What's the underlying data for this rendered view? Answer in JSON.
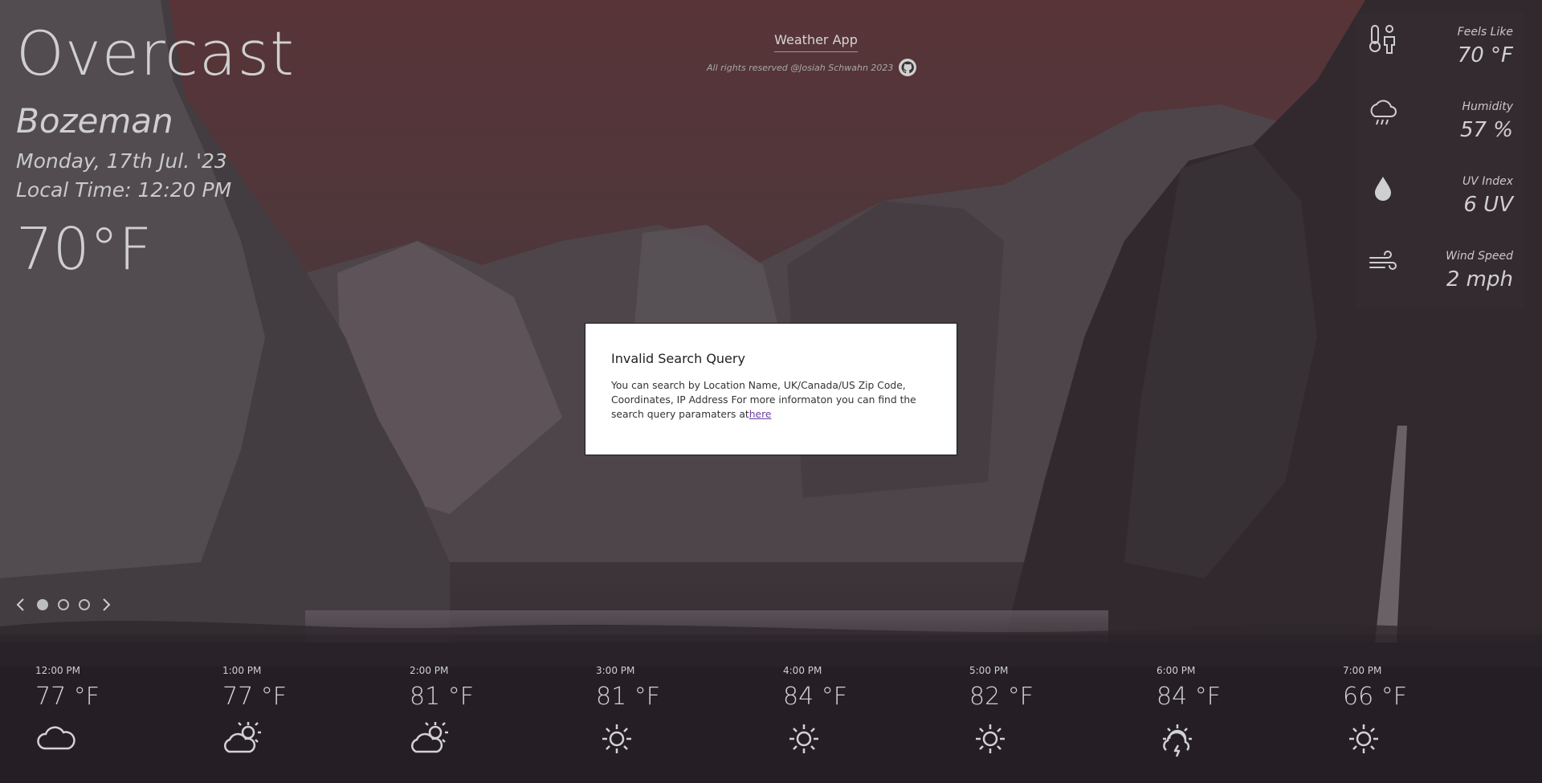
{
  "current": {
    "condition": "Overcast",
    "city": "Bozeman",
    "date": "Monday, 17th Jul. '23",
    "local_time": "Local Time: 12:20 PM",
    "temperature": "70°F"
  },
  "header": {
    "app_name": "Weather App",
    "rights": "All rights reserved @Josiah Schwahn 2023",
    "github_icon": "github-icon"
  },
  "details": [
    {
      "label": "Feels Like",
      "value": "70 °F",
      "icon": "thermometer-person-icon"
    },
    {
      "label": "Humidity",
      "value": "57 %",
      "icon": "cloud-drizzle-icon"
    },
    {
      "label": "UV Index",
      "value": "6 UV",
      "icon": "water-drop-icon"
    },
    {
      "label": "Wind Speed",
      "value": "2 mph",
      "icon": "wind-icon"
    }
  ],
  "modal": {
    "title": "Invalid Search Query",
    "body": "You can search by Location Name, UK/Canada/US Zip Code, Coordinates, IP Address For more informaton you can find the search query paramaters at",
    "link_text": "here"
  },
  "carousel": {
    "prev_icon": "chevron-left-icon",
    "next_icon": "chevron-right-icon",
    "active_index": 0,
    "count": 3
  },
  "hourly": [
    {
      "time": "12:00 PM",
      "temp": "77 °F",
      "icon": "cloud-icon"
    },
    {
      "time": "1:00 PM",
      "temp": "77 °F",
      "icon": "partly-sunny-icon"
    },
    {
      "time": "2:00 PM",
      "temp": "81 °F",
      "icon": "partly-sunny-icon"
    },
    {
      "time": "3:00 PM",
      "temp": "81 °F",
      "icon": "sun-icon"
    },
    {
      "time": "4:00 PM",
      "temp": "84 °F",
      "icon": "sun-icon"
    },
    {
      "time": "5:00 PM",
      "temp": "82 °F",
      "icon": "sun-icon"
    },
    {
      "time": "6:00 PM",
      "temp": "84 °F",
      "icon": "sun-storm-icon"
    },
    {
      "time": "7:00 PM",
      "temp": "66 °F",
      "icon": "sun-icon"
    }
  ]
}
